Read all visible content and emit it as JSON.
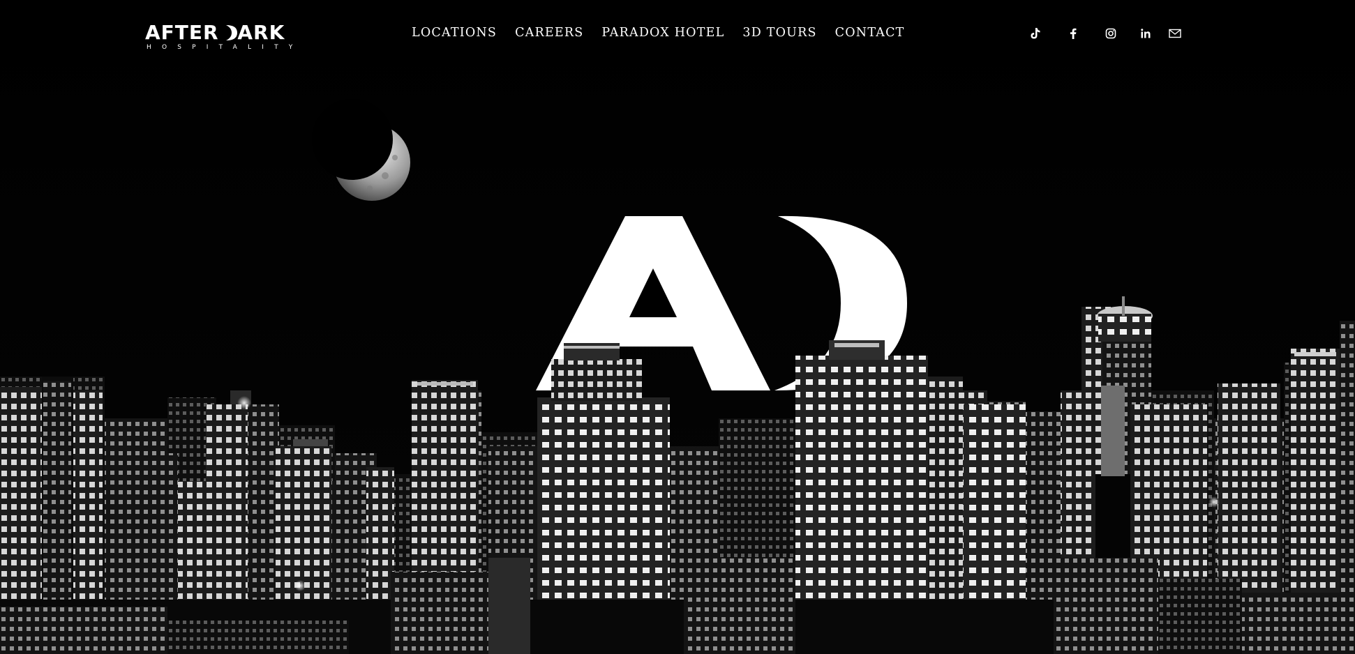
{
  "header": {
    "logo": {
      "word_part1": "AFTER ",
      "word_part2": "ARK",
      "subtitle": "HOSPITALITY"
    },
    "nav": [
      {
        "label": "LOCATIONS"
      },
      {
        "label": "CAREERS"
      },
      {
        "label": "PARADOX HOTEL"
      },
      {
        "label": "3D TOURS"
      },
      {
        "label": "CONTACT"
      }
    ],
    "social_icons": [
      "tiktok-icon",
      "facebook-icon",
      "instagram-icon",
      "linkedin-icon",
      "email-icon"
    ]
  },
  "hero": {
    "emblem": "AD",
    "colors": {
      "background": "#000000",
      "foreground": "#ffffff"
    }
  }
}
